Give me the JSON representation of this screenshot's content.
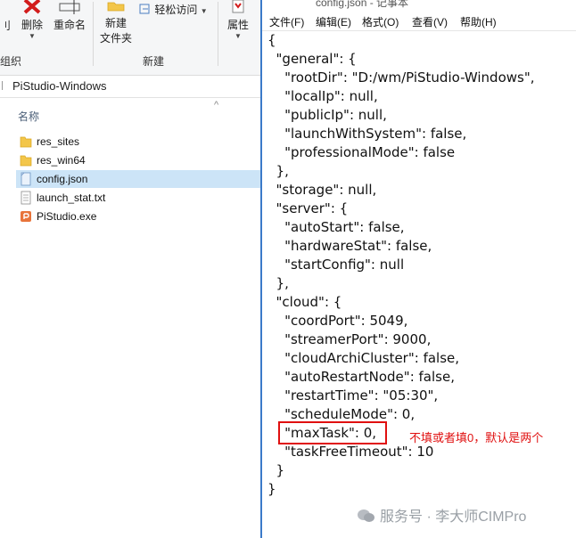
{
  "explorer": {
    "ribbon": {
      "delete_label": "删除",
      "rename_label": "重命名",
      "new_folder_label_1": "新建",
      "new_folder_label_2": "文件夹",
      "easy_access_label": "轻松访问",
      "properties_label": "属性",
      "group_organize": "组织",
      "group_new": "新建",
      "left_cut": "刂"
    },
    "address": "PiStudio-Windows",
    "column_name": "名称",
    "files": [
      {
        "name": "res_sites",
        "type": "folder"
      },
      {
        "name": "res_win64",
        "type": "folder"
      },
      {
        "name": "config.json",
        "type": "json",
        "selected": true
      },
      {
        "name": "launch_stat.txt",
        "type": "text"
      },
      {
        "name": "PiStudio.exe",
        "type": "exe"
      }
    ]
  },
  "notepad": {
    "title": "config.json - 记事本",
    "menu": [
      "文件(F)",
      "编辑(E)",
      "格式(O)",
      "查看(V)",
      "帮助(H)"
    ],
    "lines": [
      "{",
      "  \"general\": {",
      "    \"rootDir\": \"D:/wm/PiStudio-Windows\",",
      "    \"localIp\": null,",
      "    \"publicIp\": null,",
      "    \"launchWithSystem\": false,",
      "    \"professionalMode\": false",
      "  },",
      "  \"storage\": null,",
      "  \"server\": {",
      "    \"autoStart\": false,",
      "    \"hardwareStat\": false,",
      "    \"startConfig\": null",
      "  },",
      "  \"cloud\": {",
      "    \"coordPort\": 5049,",
      "    \"streamerPort\": 9000,",
      "    \"cloudArchiCluster\": false,",
      "    \"autoRestartNode\": false,",
      "    \"restartTime\": \"05:30\",",
      "    \"scheduleMode\": 0,",
      "    \"maxTask\": 0,",
      "    \"taskFreeTimeout\": 10",
      "  }",
      "}"
    ]
  },
  "annotation": "不填或者填0，默认是两个",
  "watermark": "服务号 · 李大师CIMPro",
  "colors": {
    "accent_red": "#e01010",
    "selection": "#cce4f7",
    "folder": "#f3c64a"
  }
}
